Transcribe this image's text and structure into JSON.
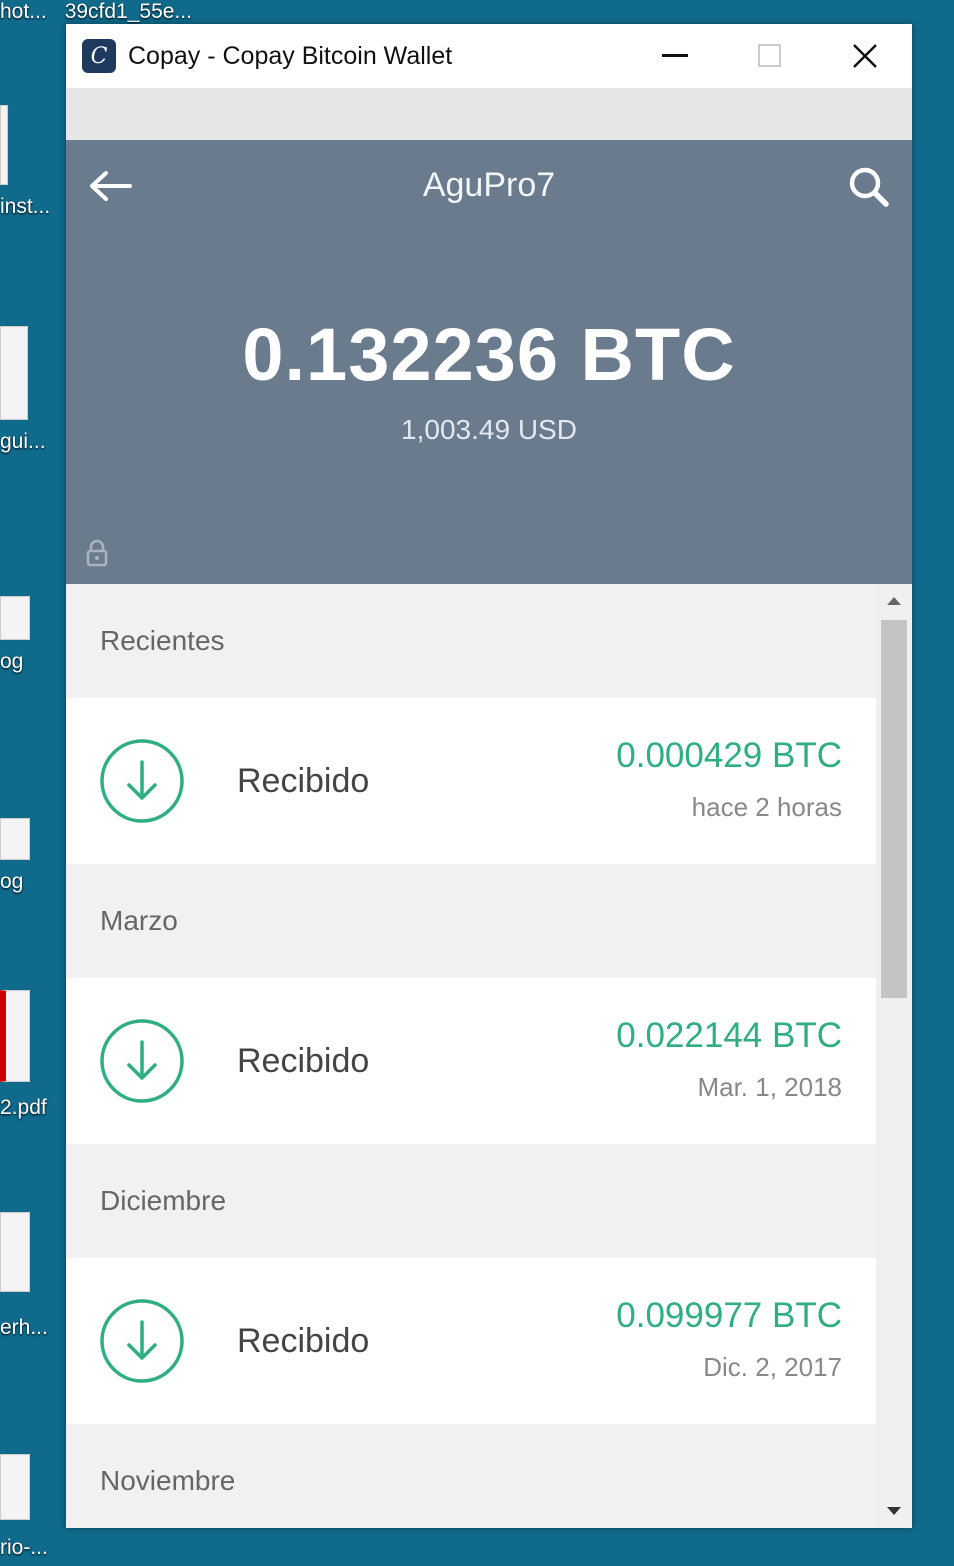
{
  "desktop": {
    "top_labels": [
      "hot...",
      "39cfd1_55e..."
    ],
    "icons": [
      {
        "label": "inst..."
      },
      {
        "label": "gui..."
      },
      {
        "label": "og"
      },
      {
        "label": "og"
      },
      {
        "label": "2.pdf"
      },
      {
        "label": "erh..."
      },
      {
        "label": "rio-..."
      }
    ]
  },
  "window": {
    "title": "Copay - Copay Bitcoin Wallet",
    "app_icon": "C",
    "controls": {
      "minimize": "—",
      "maximize": "☐",
      "close": "✕"
    }
  },
  "header": {
    "wallet_name": "AguPro7",
    "balance": "0.132236 BTC",
    "fiat": "1,003.49 USD"
  },
  "transactions": [
    {
      "section": "Recientes",
      "label": "Recibido",
      "amount": "0.000429 BTC",
      "date": "hace 2 horas"
    },
    {
      "section": "Marzo",
      "label": "Recibido",
      "amount": "0.022144 BTC",
      "date": "Mar. 1, 2018"
    },
    {
      "section": "Diciembre",
      "label": "Recibido",
      "amount": "0.099977 BTC",
      "date": "Dic. 2, 2017"
    },
    {
      "section": "Noviembre"
    }
  ],
  "colors": {
    "header_bg": "#6a7b8d",
    "received": "#2fae84",
    "desktop": "#0f6a8c"
  }
}
